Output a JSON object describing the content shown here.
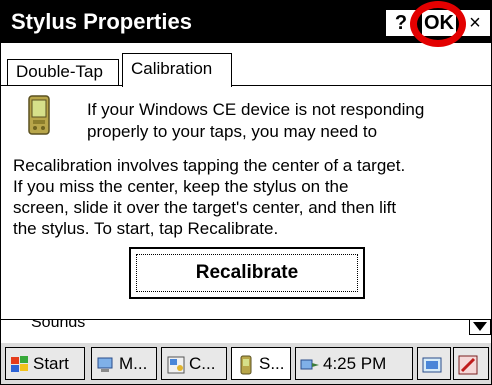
{
  "window": {
    "title": "Stylus Properties",
    "help_label": "?",
    "ok_label": "OK",
    "close_label": "×"
  },
  "tabs": [
    {
      "label": "Double-Tap",
      "selected": false
    },
    {
      "label": "Calibration",
      "selected": true
    }
  ],
  "calibration": {
    "intro_line1": "If your Windows CE device is not responding",
    "intro_line2": "properly to your taps, you may need to",
    "body_line1": "Recalibration involves tapping the center of a target.",
    "body_line2": "If you miss the center, keep the stylus on the",
    "body_line3": "screen, slide it over the target's center, and then lift",
    "body_line4": "the stylus. To start, tap Recalibrate.",
    "recalibrate_label": "Recalibrate"
  },
  "partial_row": {
    "label": "Sounds"
  },
  "taskbar": {
    "start_label": "Start",
    "items": [
      {
        "label": "M..."
      },
      {
        "label": "C..."
      },
      {
        "label": "S..."
      }
    ],
    "clock": "4:25 PM"
  },
  "colors": {
    "highlight_circle": "#e30000",
    "titlebar": "#000000"
  }
}
